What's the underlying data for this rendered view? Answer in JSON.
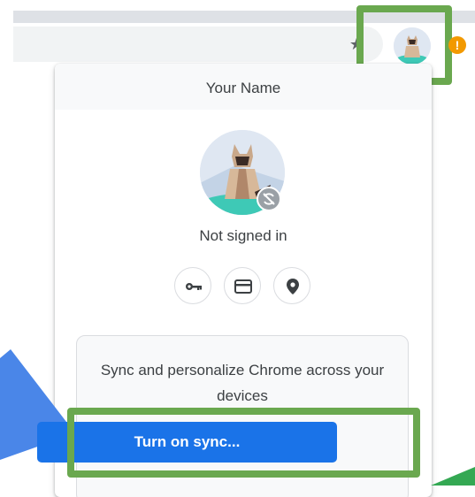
{
  "profile_menu": {
    "name": "Your Name",
    "status": "Not signed in",
    "sync_promo": "Sync and personalize Chrome across your devices",
    "sync_button_label": "Turn on sync..."
  },
  "toolbar": {
    "alert_badge": "!",
    "star_glyph": "★"
  },
  "icons": [
    "star-icon",
    "profile-avatar-icon",
    "sync-paused-icon",
    "key-icon",
    "credit-card-icon",
    "location-pin-icon",
    "update-alert-icon"
  ],
  "colors": {
    "highlight": "#6aa84f",
    "arrow": "#4a86e8",
    "sync_button": "#1a73e8",
    "alert": "#f29900"
  }
}
